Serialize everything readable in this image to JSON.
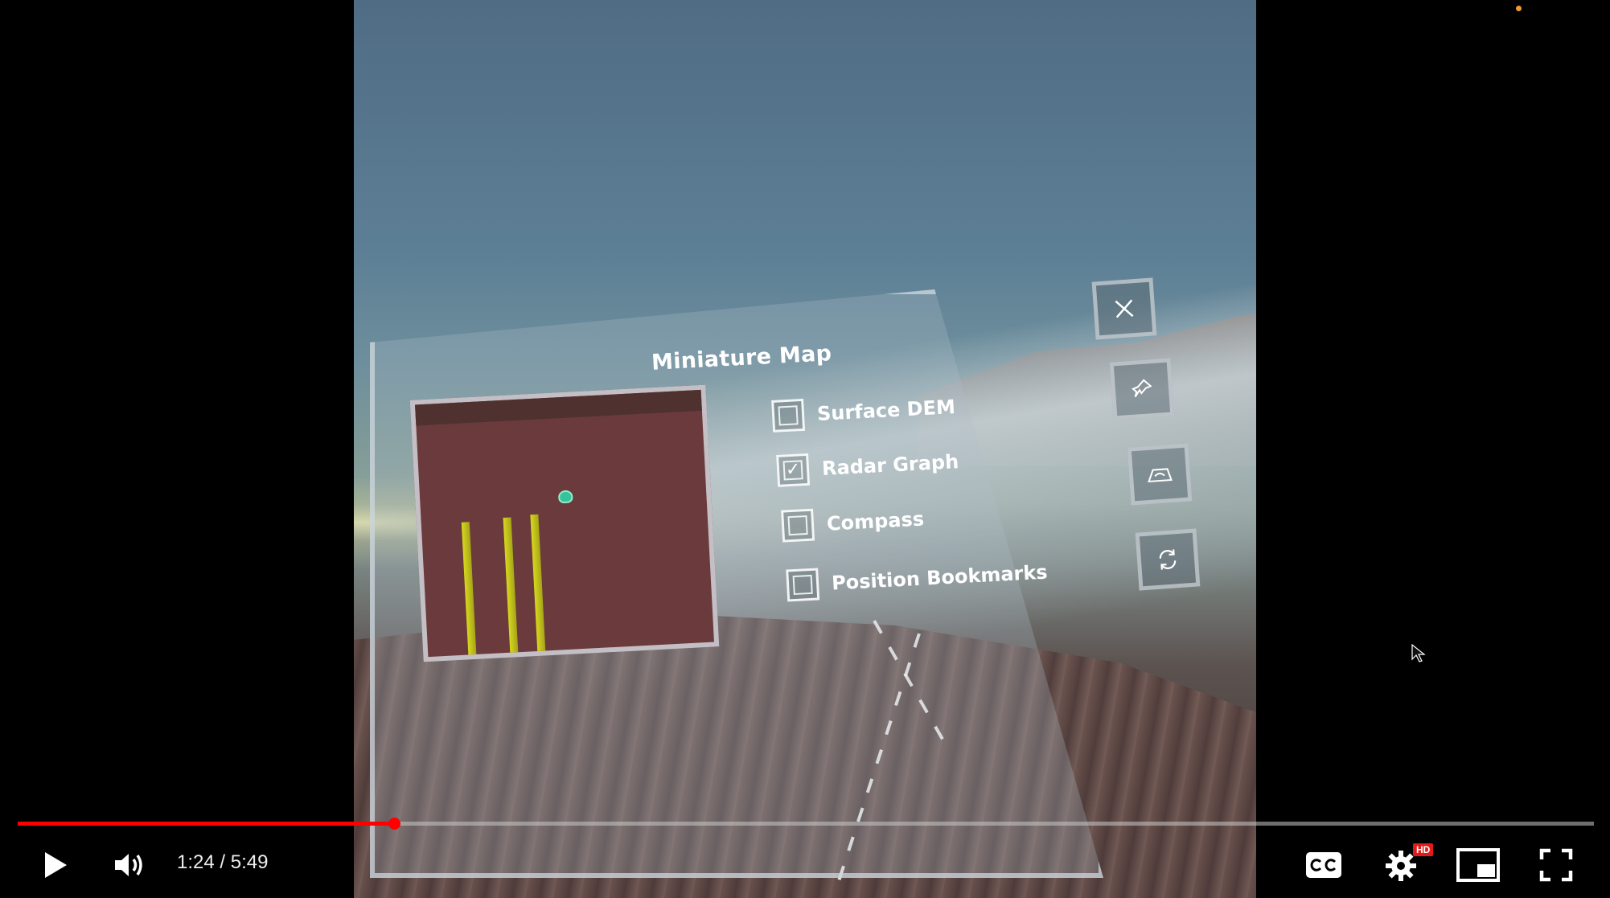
{
  "panel": {
    "title": "Miniature Map",
    "options": [
      {
        "label": "Surface DEM",
        "checked": false
      },
      {
        "label": "Radar Graph",
        "checked": true
      },
      {
        "label": "Compass",
        "checked": false
      },
      {
        "label": "Position Bookmarks",
        "checked": false
      }
    ],
    "side_buttons": [
      "close-icon",
      "pin-icon",
      "map-icon",
      "refresh-icon"
    ],
    "map_bar_color": "#d8d81e",
    "map_background_color": "#6a3a3c"
  },
  "player": {
    "current_time": "1:24",
    "total_time": "5:49",
    "time_display": "1:24 / 5:49",
    "progress_fraction": 0.2387,
    "hd_badge": "HD",
    "cc_label": "CC",
    "accent_color": "#ff0000"
  }
}
